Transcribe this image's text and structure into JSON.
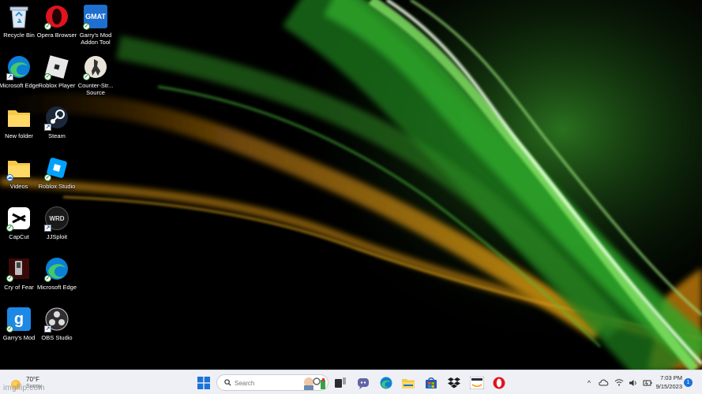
{
  "desktop": {
    "icons": [
      {
        "label": "Recycle Bin",
        "icon": "recycle-bin-icon"
      },
      {
        "label": "Opera Browser",
        "icon": "opera-icon"
      },
      {
        "label": "Garry's Mod Addon Tool",
        "icon": "gmat-icon",
        "icon_text": "GMAT"
      },
      {
        "label": "Microsoft Edge",
        "icon": "edge-icon"
      },
      {
        "label": "Roblox Player",
        "icon": "roblox-player-icon"
      },
      {
        "label": "Counter-Str... Source",
        "icon": "counter-strike-icon"
      },
      {
        "label": "New folder",
        "icon": "folder-icon"
      },
      {
        "label": "Steam",
        "icon": "steam-icon"
      },
      {
        "label": "Videos",
        "icon": "folder-icon"
      },
      {
        "label": "Roblox Studio",
        "icon": "roblox-studio-icon"
      },
      {
        "label": "CapCut",
        "icon": "capcut-icon"
      },
      {
        "label": "JJSploit",
        "icon": "jjsploit-icon",
        "icon_text": "WRD"
      },
      {
        "label": "Cry of Fear",
        "icon": "cry-of-fear-icon"
      },
      {
        "label": "Microsoft Edge",
        "icon": "edge-icon"
      },
      {
        "label": "Garry's Mod",
        "icon": "garrys-mod-icon",
        "icon_text": "g"
      },
      {
        "label": "OBS Studio",
        "icon": "obs-icon"
      }
    ]
  },
  "taskbar": {
    "weather": {
      "temp": "70°F",
      "condition": "Sunny",
      "icon": "sun-icon"
    },
    "watermark": "imgflip.com",
    "search_placeholder": "Search",
    "pinned": [
      "windows-start-icon",
      "task-view-icon",
      "teams-chat-icon",
      "edge-icon",
      "file-explorer-icon",
      "microsoft-store-icon",
      "dropbox-icon",
      "amazon-icon",
      "opera-icon"
    ],
    "tray": {
      "time": "7:03 PM",
      "date": "9/15/2023",
      "notifications": "1"
    }
  },
  "colors": {
    "taskbar_bg": "#eef0f5",
    "accent": "#1a73d9",
    "wallpaper_green": "#3cc83c",
    "wallpaper_orange": "#c8820a"
  }
}
